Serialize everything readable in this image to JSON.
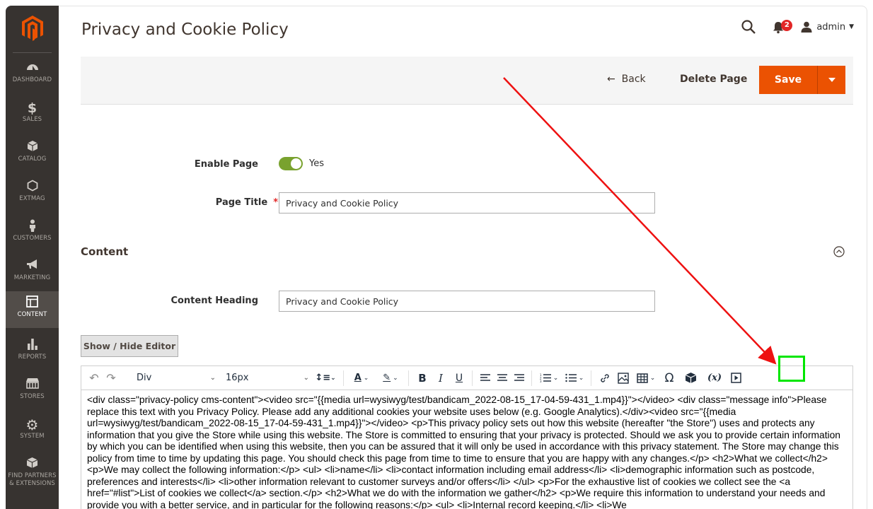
{
  "sidebar": {
    "logo": "magento-logo",
    "items": [
      {
        "label": "DASHBOARD",
        "icon": "dashboard-icon"
      },
      {
        "label": "SALES",
        "icon": "dollar-icon"
      },
      {
        "label": "CATALOG",
        "icon": "cube-icon"
      },
      {
        "label": "EXTMAG",
        "icon": "hexagon-icon"
      },
      {
        "label": "CUSTOMERS",
        "icon": "person-icon"
      },
      {
        "label": "MARKETING",
        "icon": "megaphone-icon"
      },
      {
        "label": "CONTENT",
        "icon": "layout-icon",
        "active": true
      },
      {
        "label": "REPORTS",
        "icon": "bar-chart-icon"
      },
      {
        "label": "STORES",
        "icon": "store-icon"
      },
      {
        "label": "SYSTEM",
        "icon": "gear-icon"
      },
      {
        "label": "FIND PARTNERS",
        "label2": "& EXTENSIONS",
        "icon": "box-icon"
      }
    ]
  },
  "header": {
    "title": "Privacy and Cookie Policy",
    "notification_count": "2",
    "user": "admin"
  },
  "actions": {
    "back": "Back",
    "delete": "Delete Page",
    "save": "Save"
  },
  "form": {
    "enable_label": "Enable Page",
    "enable_value": "Yes",
    "title_label": "Page Title",
    "title_value": "Privacy and Cookie Policy",
    "required_mark": "*"
  },
  "content_section": {
    "title": "Content",
    "heading_label": "Content Heading",
    "heading_value": "Privacy and Cookie Policy",
    "show_hide": "Show / Hide Editor"
  },
  "toolbar": {
    "block_format": "Div",
    "font_size": "16px",
    "variable_label": "(x)"
  },
  "editor": {
    "text": "<div class=\"privacy-policy cms-content\"><video src=\"{{media url=wysiwyg/test/bandicam_2022-08-15_17-04-59-431_1.mp4}}\"></video> <div class=\"message info\">Please replace this text with you Privacy Policy. Please add any additional cookies your website uses below (e.g. Google Analytics).</div><video src=\"{{media url=wysiwyg/test/bandicam_2022-08-15_17-04-59-431_1.mp4}}\"></video> <p>This privacy policy sets out how this website (hereafter \"the Store\") uses and protects any information that you give the Store while using this website. The Store is committed to ensuring that your privacy is protected. Should we ask you to provide certain information by which you can be identified when using this website, then you can be assured that it will only be used in accordance with this privacy statement. The Store may change this policy from time to time by updating this page. You should check this page from time to time to ensure that you are happy with any changes.</p> <h2>What we collect</h2> <p>We may collect the following information:</p> <ul> <li>name</li> <li>contact information including email address</li> <li>demographic information such as postcode, preferences and interests</li> <li>other information relevant to customer surveys and/or offers</li> </ul> <p>For the exhaustive list of cookies we collect see the <a href=\"#list\">List of cookies we collect</a> section.</p> <h2>What we do with the information we gather</h2> <p>We require this information to understand your needs and provide you with a better service, and in particular for the following reasons:</p> <ul> <li>Internal record keeping.</li> <li>We"
  },
  "colors": {
    "sidebar": "#373330",
    "accent": "#eb5202",
    "toggle_on": "#79a22e",
    "annotation_arrow": "#ee1111",
    "annotation_box": "#00e600"
  }
}
